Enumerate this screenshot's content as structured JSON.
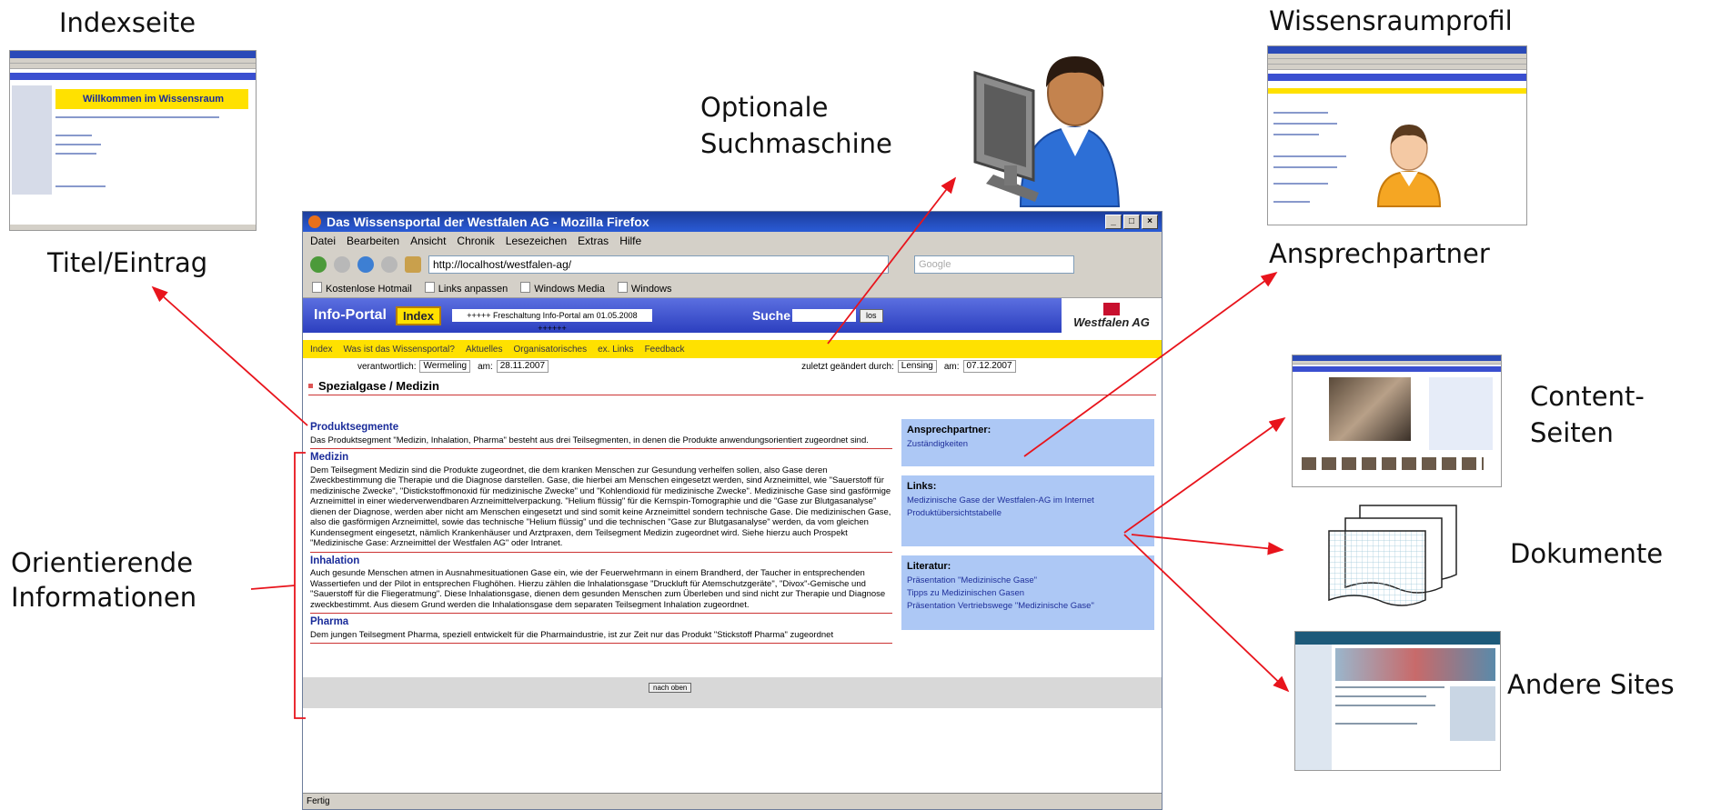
{
  "labels": {
    "indexseite": "Indexseite",
    "titel_eintrag": "Titel/Eintrag",
    "optionale_suchmaschine_1": "Optionale",
    "optionale_suchmaschine_2": "Suchmaschine",
    "wissensraumprofil": "Wissensraumprofil",
    "ansprechpartner": "Ansprechpartner",
    "content_seiten_1": "Content-",
    "content_seiten_2": "Seiten",
    "dokumente": "Dokumente",
    "andere_sites": "Andere Sites",
    "orientierende_1": "Orientierende",
    "orientierende_2": "Informationen"
  },
  "colors": {
    "arrow": "#e8141c",
    "portal_blue": "#3a4fd0",
    "portal_yellow": "#ffe100",
    "link_box": "#adc8f5"
  },
  "browser": {
    "window_title": "Das Wissensportal der Westfalen AG - Mozilla Firefox",
    "menu": [
      "Datei",
      "Bearbeiten",
      "Ansicht",
      "Chronik",
      "Lesezeichen",
      "Extras",
      "Hilfe"
    ],
    "url": "http://localhost/westfalen-ag/",
    "search_placeholder": "Google",
    "bookmarks": [
      "Kostenlose Hotmail",
      "Links anpassen",
      "Windows Media",
      "Windows"
    ],
    "status": "Fertig"
  },
  "portal": {
    "title": "Info-Portal",
    "index_button": "Index",
    "news_ticker": "+++++  Freschaltung Info-Portal am 01.05.2008 ++++++",
    "search_label": "Suche",
    "search_button": "los",
    "logo_text": "Westfalen AG",
    "nav": [
      "Index",
      "Was ist das Wissensportal?",
      "Aktuelles",
      "Organisatorisches",
      "ex. Links",
      "Feedback"
    ],
    "meta": {
      "responsible_label": "verantwortlich:",
      "responsible_value": "Wermeling",
      "date_label": "am:",
      "date_value": "28.11.2007",
      "changed_label": "zuletzt geändert durch:",
      "changed_value": "Lensing",
      "changed_date_label": "am:",
      "changed_date_value": "07.12.2007"
    },
    "page_title": "Spezialgase / Medizin",
    "sections": [
      {
        "heading": "Produktsegmente",
        "text": "Das Produktsegment \"Medizin, Inhalation, Pharma\" besteht aus drei Teilsegmenten, in denen die Produkte anwendungsorientiert zugeordnet sind."
      },
      {
        "heading": "Medizin",
        "text": "Dem Teilsegment Medizin sind die Produkte zugeordnet, die dem kranken Menschen zur Gesundung verhelfen sollen, also Gase deren Zweckbestimmung die Therapie und die Diagnose darstellen. Gase, die hierbei am Menschen eingesetzt werden, sind Arzneimittel, wie \"Sauerstoff für medizinische Zwecke\", \"Distickstoffmonoxid für medizinische Zwecke\" und \"Kohlendioxid für medizinische Zwecke\". Medizinische Gase sind gasförmige Arzneimittel in einer wiederverwendbaren Arzneimittelverpackung. \"Helium flüssig\" für die Kernspin-Tomographie und die \"Gase zur Blutgasanalyse\" dienen der Diagnose, werden aber nicht am Menschen eingesetzt und sind somit keine Arzneimittel sondern technische Gase. Die medizinischen Gase, also die gasförmigen Arzneimittel, sowie das technische \"Helium flüssig\" und die technischen \"Gase zur Blutgasanalyse\" werden, da vom gleichen Kundensegment eingesetzt, nämlich Krankenhäuser und Arztpraxen, dem Teilsegment Medizin zugeordnet wird. Siehe hierzu auch Prospekt \"Medizinische Gase: Arzneimittel der Westfalen AG\" oder Intranet."
      },
      {
        "heading": "Inhalation",
        "text": "Auch gesunde Menschen atmen in Ausnahmesituationen Gase ein, wie der Feuerwehrmann in einem Brandherd, der Taucher in entsprechenden Wassertiefen und der Pilot in entsprechen Flughöhen. Hierzu zählen die Inhalationsgase \"Druckluft für Atemschutzgeräte\", \"Divox\"-Gemische und \"Sauerstoff für die Fliegeratmung\". Diese Inhalationsgase, dienen dem gesunden Menschen zum Überleben und sind nicht zur Therapie und Diagnose zweckbestimmt. Aus diesem Grund werden die Inhalationsgase dem separaten Teilsegment Inhalation zugeordnet."
      },
      {
        "heading": "Pharma",
        "text": "Dem jungen Teilsegment Pharma, speziell entwickelt für die Pharmaindustrie, ist zur Zeit nur das Produkt \"Stickstoff Pharma\" zugeordnet"
      }
    ],
    "sidebar": {
      "contact": {
        "title": "Ansprechpartner:",
        "links": [
          "Zuständigkeiten"
        ]
      },
      "links": {
        "title": "Links:",
        "links": [
          "Medizinische Gase der Westfalen-AG im Internet",
          "Produktübersichtstabelle"
        ]
      },
      "literature": {
        "title": "Literatur:",
        "links": [
          "Präsentation \"Medizinische Gase\"",
          "Tipps zu Medizinischen Gasen",
          "Präsentation Vertriebswege \"Medizinische Gase\""
        ]
      }
    },
    "scroll_up": "nach oben"
  },
  "index_thumb": {
    "welcome": "Willkommen im Wissensraum"
  }
}
